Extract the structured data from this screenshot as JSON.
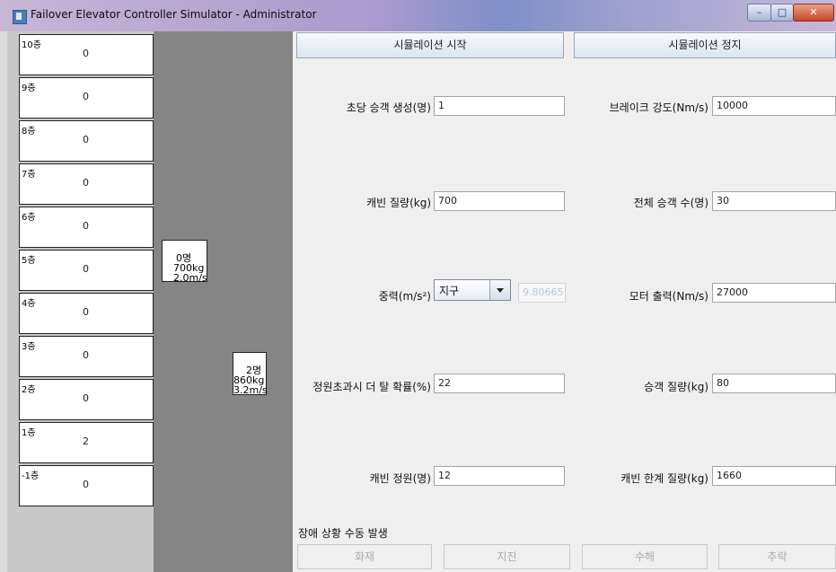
{
  "window": {
    "title": "Failover Elevator Controller Simulator - Administrator",
    "controls": {
      "minimize": "–",
      "maximize": "□",
      "close": "✕"
    }
  },
  "floors": [
    {
      "label": "10층",
      "count": "0"
    },
    {
      "label": "9층",
      "count": "0"
    },
    {
      "label": "8층",
      "count": "0"
    },
    {
      "label": "7층",
      "count": "0"
    },
    {
      "label": "6층",
      "count": "0"
    },
    {
      "label": "5층",
      "count": "0"
    },
    {
      "label": "4층",
      "count": "0"
    },
    {
      "label": "3층",
      "count": "0"
    },
    {
      "label": "2층",
      "count": "0"
    },
    {
      "label": "1층",
      "count": "2"
    },
    {
      "label": "-1층",
      "count": "0"
    }
  ],
  "cars": [
    {
      "passengers": "0명",
      "weight": "700kg",
      "speed": "2.0m/s"
    },
    {
      "passengers": "2명",
      "weight": "860kg",
      "speed": "3.2m/s"
    }
  ],
  "controls": {
    "start_label": "시뮬레이션 시작",
    "stop_label": "시뮬레이션 정지"
  },
  "params": {
    "passengers_per_sec": {
      "label": "초당 승객 생성(명)",
      "value": "1"
    },
    "brake_strength": {
      "label": "브레이크 강도(Nm/s)",
      "value": "10000"
    },
    "cabin_mass": {
      "label": "캐빈 질량(kg)",
      "value": "700"
    },
    "total_passengers": {
      "label": "전체 승객 수(명)",
      "value": "30"
    },
    "gravity": {
      "label": "중력(m/s²)",
      "selected": "지구",
      "value": "9.80665"
    },
    "motor_output": {
      "label": "모터 출력(Nm/s)",
      "value": "27000"
    },
    "overcapacity_prob": {
      "label": "정원초과시 더 탈 확률(%)",
      "value": "22"
    },
    "passenger_mass": {
      "label": "승객 질량(kg)",
      "value": "80"
    },
    "cabin_capacity": {
      "label": "캐빈 정원(명)",
      "value": "12"
    },
    "cabin_max_mass": {
      "label": "캐빈 한계 질량(kg)",
      "value": "1660"
    }
  },
  "failures": {
    "section_title": "장애 상황 수동 발생",
    "buttons": [
      "화재",
      "지진",
      "수해",
      "추락"
    ]
  }
}
